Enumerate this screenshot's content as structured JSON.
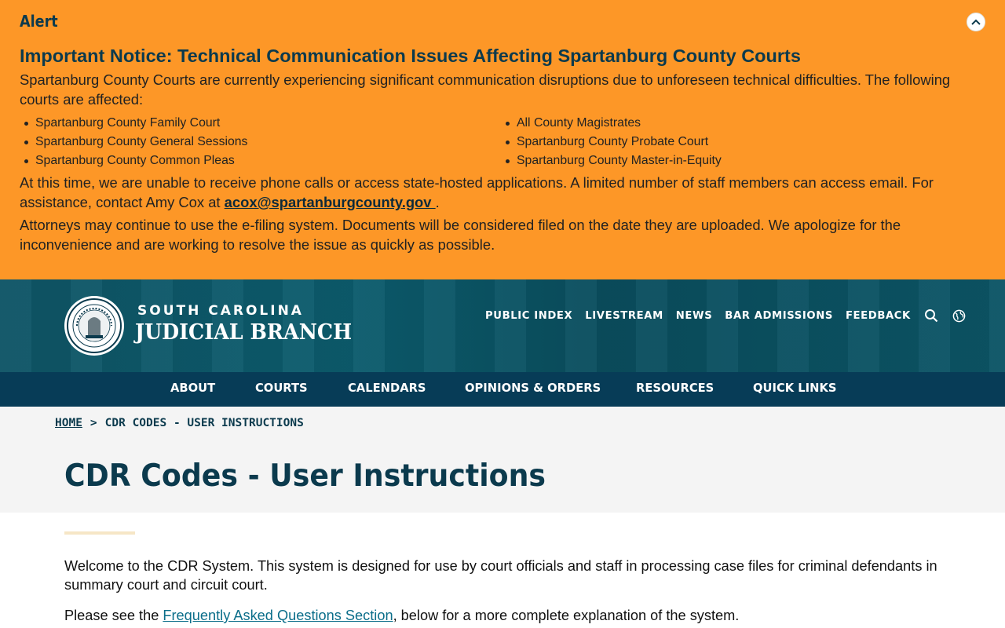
{
  "alert": {
    "label": "Alert",
    "heading": "Important Notice: Technical Communication Issues Affecting Spartanburg County Courts",
    "intro": "Spartanburg County Courts are currently experiencing significant communication disruptions due to unforeseen technical difficulties. The following courts are affected:",
    "courts_left": [
      "Spartanburg County Family Court",
      "Spartanburg County General Sessions",
      "Spartanburg County Common Pleas"
    ],
    "courts_right": [
      "All County Magistrates",
      "Spartanburg County Probate Court",
      "Spartanburg County Master-in-Equity"
    ],
    "para2_before": "At this time, we are unable to receive phone calls or access state-hosted applications. A limited number of staff members can access email. For assistance, contact Amy Cox at ",
    "para2_email": "acox@spartanburgcounty.gov ",
    "para2_after": ".",
    "para3": "Attorneys may continue to use the e-filing system. Documents will be considered filed on the date they are uploaded. We apologize for the inconvenience and are working to resolve the issue as quickly as possible.",
    "background_color": "#fd9727"
  },
  "header": {
    "brand_top": "SOUTH CAROLINA",
    "brand_main": "JUDICIAL BRANCH",
    "utility_links": [
      "PUBLIC INDEX",
      "LIVESTREAM",
      "NEWS",
      "BAR ADMISSIONS",
      "FEEDBACK"
    ],
    "icons": [
      "search-icon",
      "globe-icon"
    ]
  },
  "main_nav": [
    "ABOUT",
    "COURTS",
    "CALENDARS",
    "OPINIONS & ORDERS",
    "RESOURCES",
    "QUICK LINKS"
  ],
  "breadcrumb": {
    "home": "HOME",
    "separator": ">",
    "current": "CDR CODES - USER INSTRUCTIONS"
  },
  "page": {
    "title": "CDR Codes - User Instructions",
    "para1": "Welcome to the CDR System. This system is designed for use by court officials and staff in processing case files for criminal defendants in summary court and circuit court.",
    "para2_before": "Please see the ",
    "para2_link": "Frequently Asked Questions Section",
    "para2_after": ", below for a more complete explanation of the system."
  },
  "colors": {
    "navy": "#073c57",
    "teal": "#0c5c6d",
    "title": "#0b3a4d"
  }
}
